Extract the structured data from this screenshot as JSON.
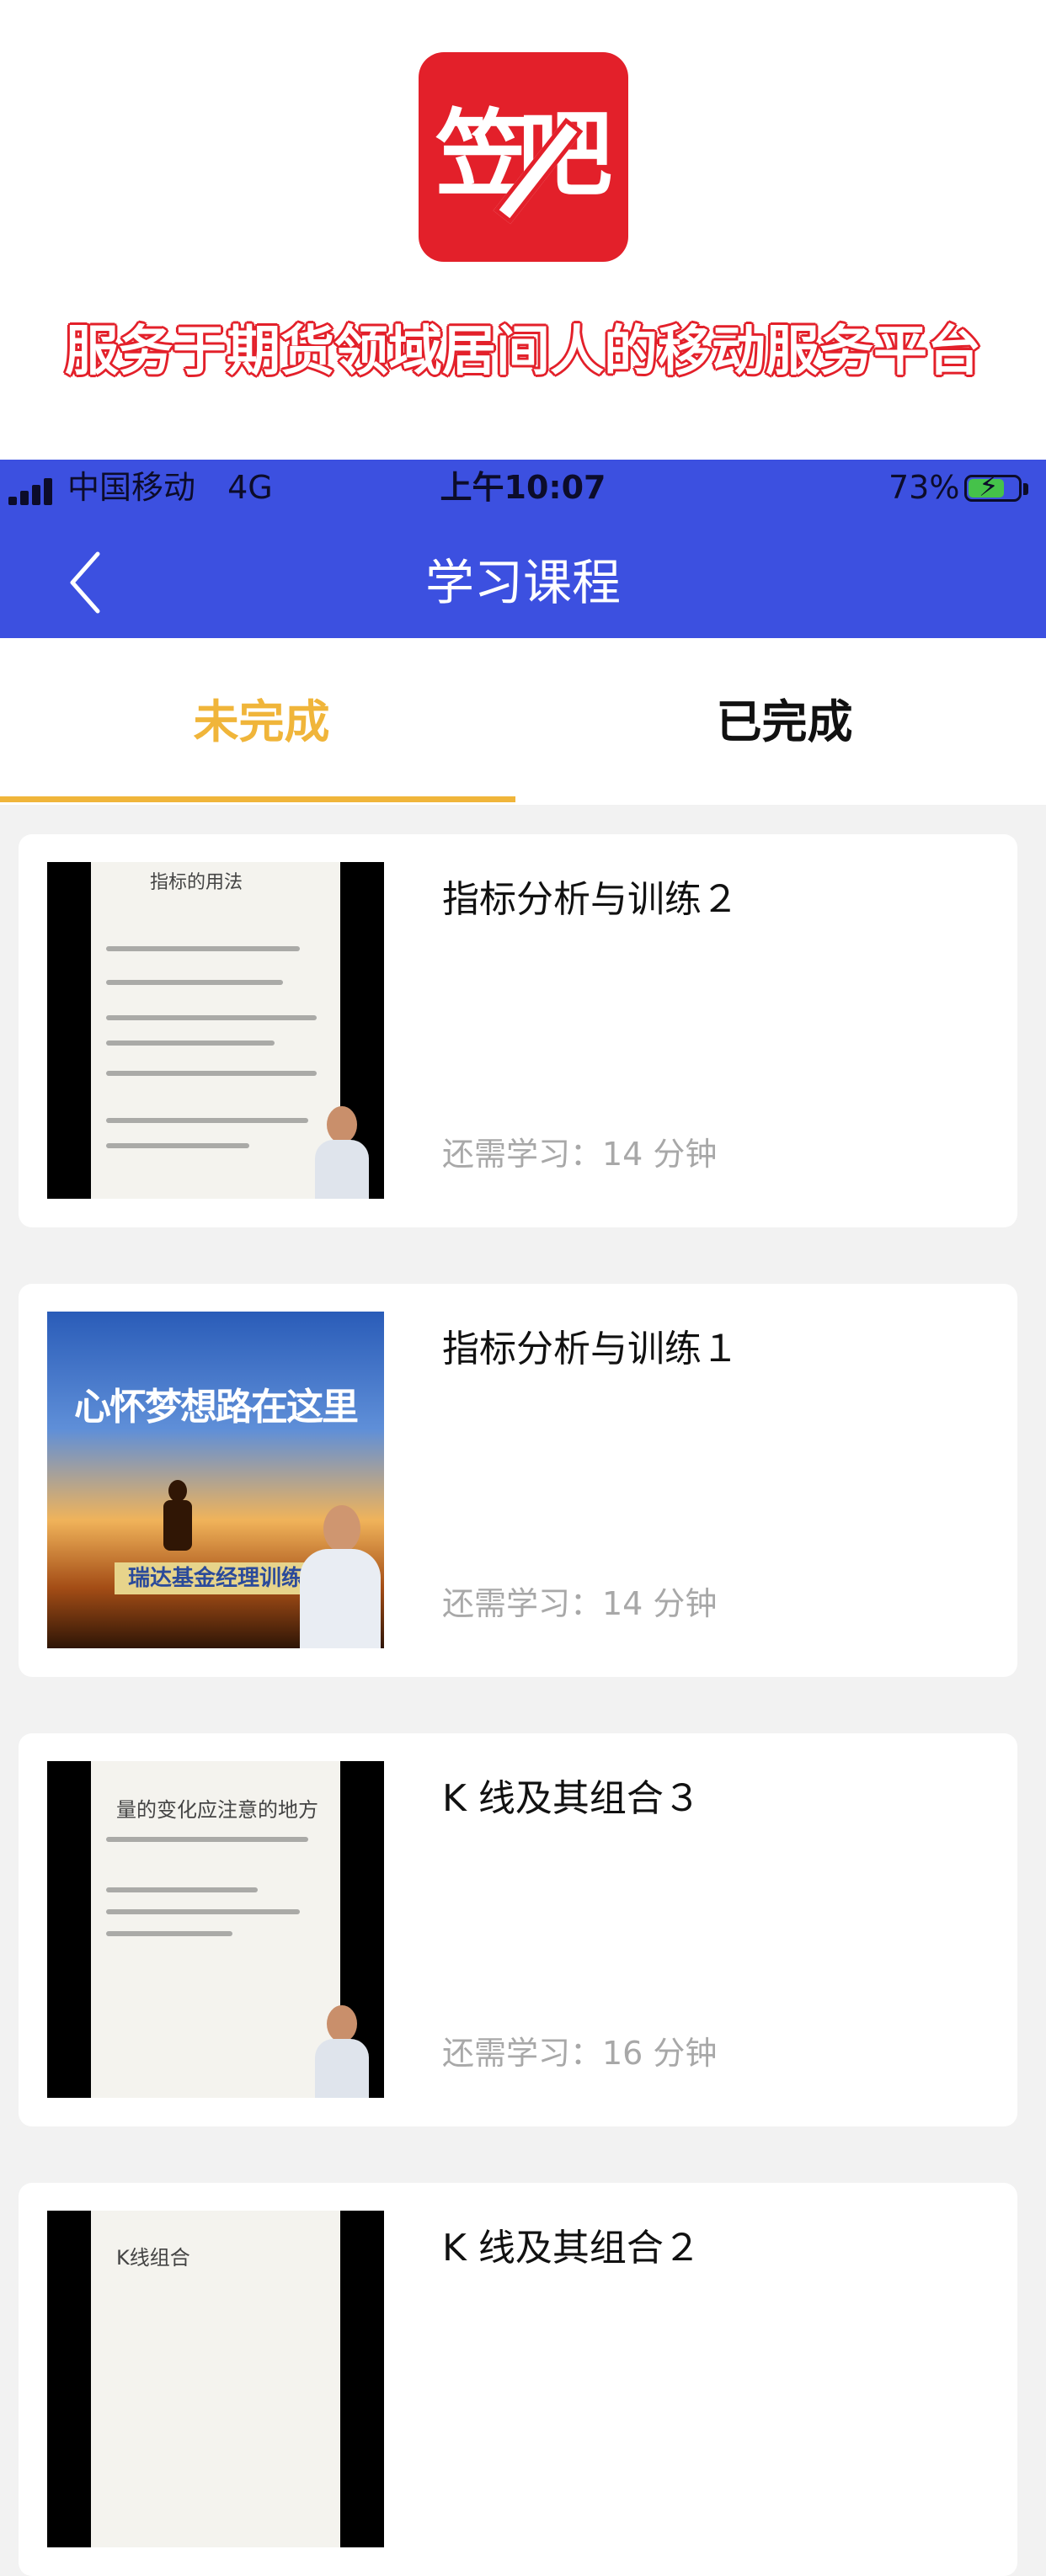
{
  "banner": {
    "logo_chars": [
      "笠",
      "吧"
    ],
    "slogan": "服务于期货领域居间人的移动服务平台",
    "brand_color": "#e3202a"
  },
  "status_bar": {
    "carrier": "中国移动",
    "network": "4G",
    "time": "上午10:07",
    "battery_percent": "73%",
    "battery_level": 0.73,
    "charging": true
  },
  "nav": {
    "back_icon": "chevron-left-icon",
    "title": "学习课程",
    "color": "#3c50e0"
  },
  "tabs": {
    "items": [
      {
        "label": "未完成",
        "active": true
      },
      {
        "label": "已完成",
        "active": false
      }
    ],
    "active_color": "#f0b53a"
  },
  "courses": [
    {
      "title": "指标分析与训练２",
      "remaining": "还需学习：14 分钟",
      "thumb_text": "指标的用法"
    },
    {
      "title": "指标分析与训练１",
      "remaining": "还需学习：14 分钟",
      "thumb_text": "心怀梦想路在这里",
      "thumb_band": "瑞达基金经理训练"
    },
    {
      "title": "K 线及其组合３",
      "remaining": "还需学习：16 分钟",
      "thumb_text": "量的变化应注意的地方"
    },
    {
      "title": "K 线及其组合２",
      "remaining": "",
      "thumb_text": "K线组合"
    }
  ]
}
